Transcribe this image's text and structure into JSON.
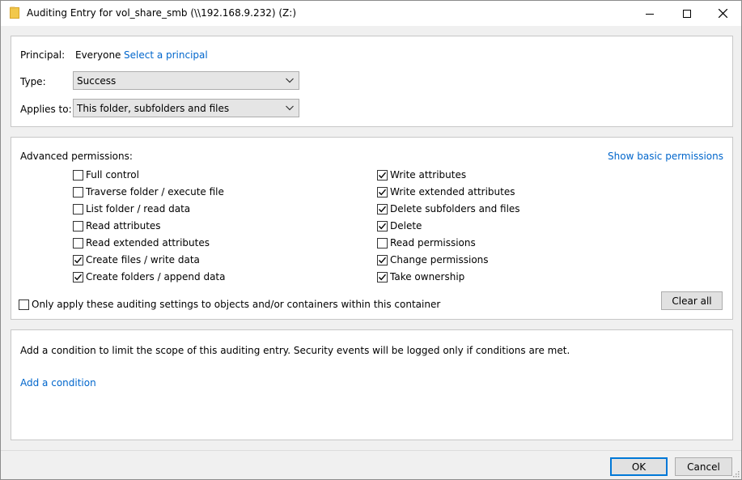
{
  "window": {
    "title": "Auditing Entry for vol_share_smb (\\\\192.168.9.232) (Z:)",
    "icon": "folder-icon"
  },
  "principal": {
    "label": "Principal:",
    "value": "Everyone",
    "select_link": "Select a principal"
  },
  "type": {
    "label": "Type:",
    "selected": "Success"
  },
  "applies_to": {
    "label": "Applies to:",
    "selected": "This folder, subfolders and files"
  },
  "advanced": {
    "heading": "Advanced permissions:",
    "show_basic_link": "Show basic permissions",
    "left": [
      {
        "label": "Full control",
        "checked": false
      },
      {
        "label": "Traverse folder / execute file",
        "checked": false
      },
      {
        "label": "List folder / read data",
        "checked": false
      },
      {
        "label": "Read attributes",
        "checked": false
      },
      {
        "label": "Read extended attributes",
        "checked": false
      },
      {
        "label": "Create files / write data",
        "checked": true
      },
      {
        "label": "Create folders / append data",
        "checked": true
      }
    ],
    "right": [
      {
        "label": "Write attributes",
        "checked": true
      },
      {
        "label": "Write extended attributes",
        "checked": true
      },
      {
        "label": "Delete subfolders and files",
        "checked": true
      },
      {
        "label": "Delete",
        "checked": true
      },
      {
        "label": "Read permissions",
        "checked": false
      },
      {
        "label": "Change permissions",
        "checked": true
      },
      {
        "label": "Take ownership",
        "checked": true
      }
    ],
    "only_apply": {
      "label": "Only apply these auditing settings to objects and/or containers within this container",
      "checked": false
    },
    "clear_all": "Clear all"
  },
  "condition": {
    "description": "Add a condition to limit the scope of this auditing entry. Security events will be logged only if conditions are met.",
    "add_link": "Add a condition"
  },
  "buttons": {
    "ok": "OK",
    "cancel": "Cancel"
  },
  "colors": {
    "link": "#0066cc",
    "accent": "#0078d7"
  }
}
